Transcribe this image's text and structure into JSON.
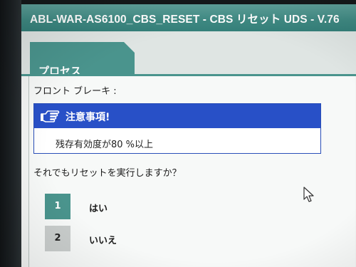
{
  "window": {
    "title": "ABL-WAR-AS6100_CBS_RESET - CBS リセット UDS - V.76"
  },
  "tabs": [
    {
      "label": "プロセス",
      "active": true
    }
  ],
  "section": {
    "label": "フロント ブレーキ :"
  },
  "notice": {
    "icon": "hand-pointing-icon",
    "title": "注意事項!",
    "body": "残存有効度が80 %以上"
  },
  "prompt": {
    "question": "それでもリセットを実行しますか？"
  },
  "options": [
    {
      "number": "1",
      "label": "はい",
      "selected": true
    },
    {
      "number": "2",
      "label": "いいえ",
      "selected": false
    }
  ],
  "colors": {
    "accent": "#4a948d",
    "notice_header": "#2850c7",
    "unselected_option": "#c9cdcc"
  }
}
